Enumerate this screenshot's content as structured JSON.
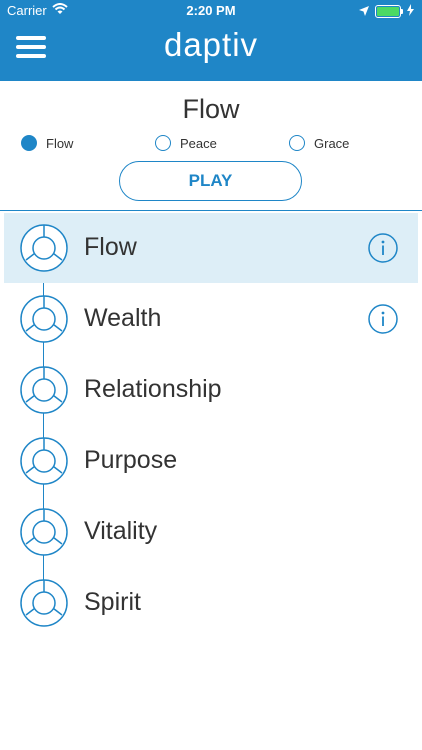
{
  "status": {
    "carrier": "Carrier",
    "time": "2:20 PM"
  },
  "header": {
    "brand": "daptiv",
    "menu_icon": "hamburger-menu-icon"
  },
  "page": {
    "title": "Flow"
  },
  "options": [
    {
      "label": "Flow",
      "selected": true
    },
    {
      "label": "Peace",
      "selected": false
    },
    {
      "label": "Grace",
      "selected": false
    }
  ],
  "play": {
    "label": "PLAY"
  },
  "items": [
    {
      "label": "Flow",
      "selected": true,
      "info": true
    },
    {
      "label": "Wealth",
      "selected": false,
      "info": true
    },
    {
      "label": "Relationship",
      "selected": false,
      "info": false
    },
    {
      "label": "Purpose",
      "selected": false,
      "info": false
    },
    {
      "label": "Vitality",
      "selected": false,
      "info": false
    },
    {
      "label": "Spirit",
      "selected": false,
      "info": false
    }
  ],
  "colors": {
    "accent": "#1f86c7",
    "selected_row": "#ddeef7",
    "battery": "#4cd964"
  }
}
